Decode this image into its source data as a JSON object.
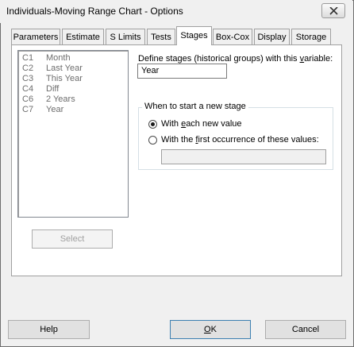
{
  "window": {
    "title": "Individuals-Moving Range Chart - Options",
    "close_symbol": "✕"
  },
  "tabs": [
    {
      "label": "Parameters",
      "selected": false
    },
    {
      "label": "Estimate",
      "selected": false
    },
    {
      "label": "S Limits",
      "selected": false
    },
    {
      "label": "Tests",
      "selected": false
    },
    {
      "label": "Stages",
      "selected": true
    },
    {
      "label": "Box-Cox",
      "selected": false
    },
    {
      "label": "Display",
      "selected": false
    },
    {
      "label": "Storage",
      "selected": false
    }
  ],
  "variables": [
    {
      "col": "C1",
      "name": "Month"
    },
    {
      "col": "C2",
      "name": "Last Year"
    },
    {
      "col": "C3",
      "name": "This Year"
    },
    {
      "col": "C4",
      "name": "Diff"
    },
    {
      "col": "C6",
      "name": "2 Years"
    },
    {
      "col": "C7",
      "name": "Year"
    }
  ],
  "select_button": "Select",
  "stages": {
    "define_label_before": "Define stages (historical groups) with this ",
    "define_label_ul": "v",
    "define_label_after": "ariable:",
    "define_value": "Year",
    "group_label": "When to start a new stage",
    "option1_before": "With ",
    "option1_ul": "e",
    "option1_after": "ach new value",
    "option1_selected": true,
    "option2_before": "With the ",
    "option2_ul": "f",
    "option2_after": "irst occurrence of these values:",
    "option2_selected": false,
    "values_value": ""
  },
  "buttons": {
    "help": "Help",
    "ok_ul": "O",
    "ok_rest": "K",
    "cancel": "Cancel"
  }
}
